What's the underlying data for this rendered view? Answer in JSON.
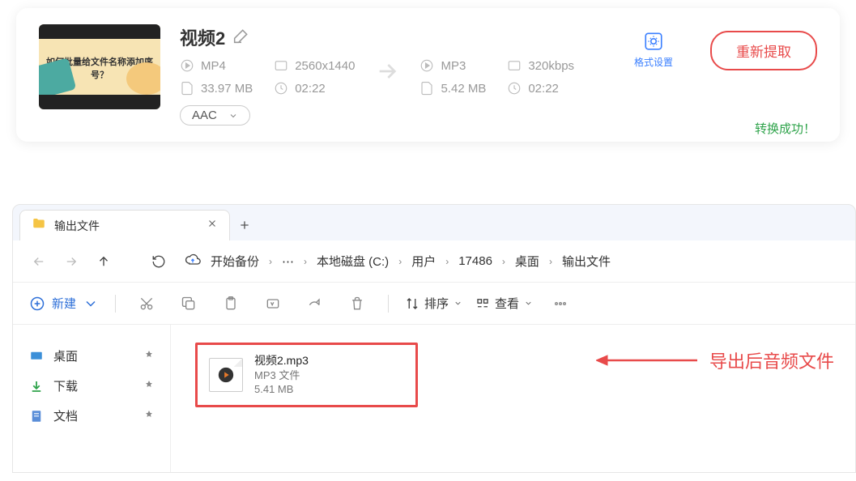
{
  "converter": {
    "thumb_caption": "如何批量给文件名称添加序号？",
    "title": "视频2",
    "source": {
      "format": "MP4",
      "resolution": "2560x1440",
      "size": "33.97 MB",
      "duration": "02:22"
    },
    "target": {
      "format": "MP3",
      "bitrate": "320kbps",
      "size": "5.42 MB",
      "duration": "02:22"
    },
    "codec_selected": "AAC",
    "format_settings_label": "格式设置",
    "reextract_label": "重新提取",
    "success_label": "转换成功！"
  },
  "explorer": {
    "tab_name": "输出文件",
    "breadcrumb": {
      "backup": "开始备份",
      "segs": [
        "本地磁盘 (C:)",
        "用户",
        "17486",
        "桌面",
        "输出文件"
      ]
    },
    "toolbar": {
      "new": "新建",
      "sort": "排序",
      "view": "查看"
    },
    "sidebar": {
      "desktop": "桌面",
      "downloads": "下载",
      "documents": "文档"
    },
    "file": {
      "name": "视频2.mp3",
      "kind": "MP3 文件",
      "size": "5.41 MB"
    },
    "annotation": "导出后音频文件"
  }
}
